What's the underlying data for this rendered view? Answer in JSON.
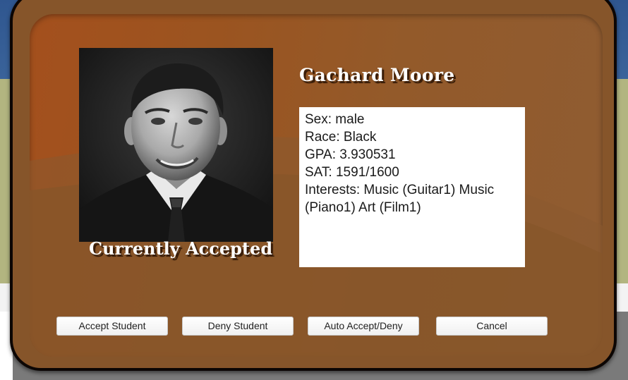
{
  "student": {
    "name": "Gachard Moore",
    "status": "Currently Accepted",
    "photo_icon": "student-portrait",
    "info": {
      "sex": "Sex: male",
      "race": "Race: Black",
      "gpa": "GPA: 3.930531",
      "sat": "SAT: 1591/1600",
      "interests": "Interests: Music (Guitar1) Music (Piano1) Art (Film1)"
    }
  },
  "buttons": {
    "accept": "Accept Student",
    "deny": "Deny Student",
    "auto": "Auto Accept/Deny",
    "cancel": "Cancel"
  },
  "colors": {
    "dialog_frame": "#86552a",
    "dialog_panel": "#9b5420",
    "border": "#0c0604",
    "background_top": "#2f568f",
    "background_olive": "#b2b580"
  }
}
